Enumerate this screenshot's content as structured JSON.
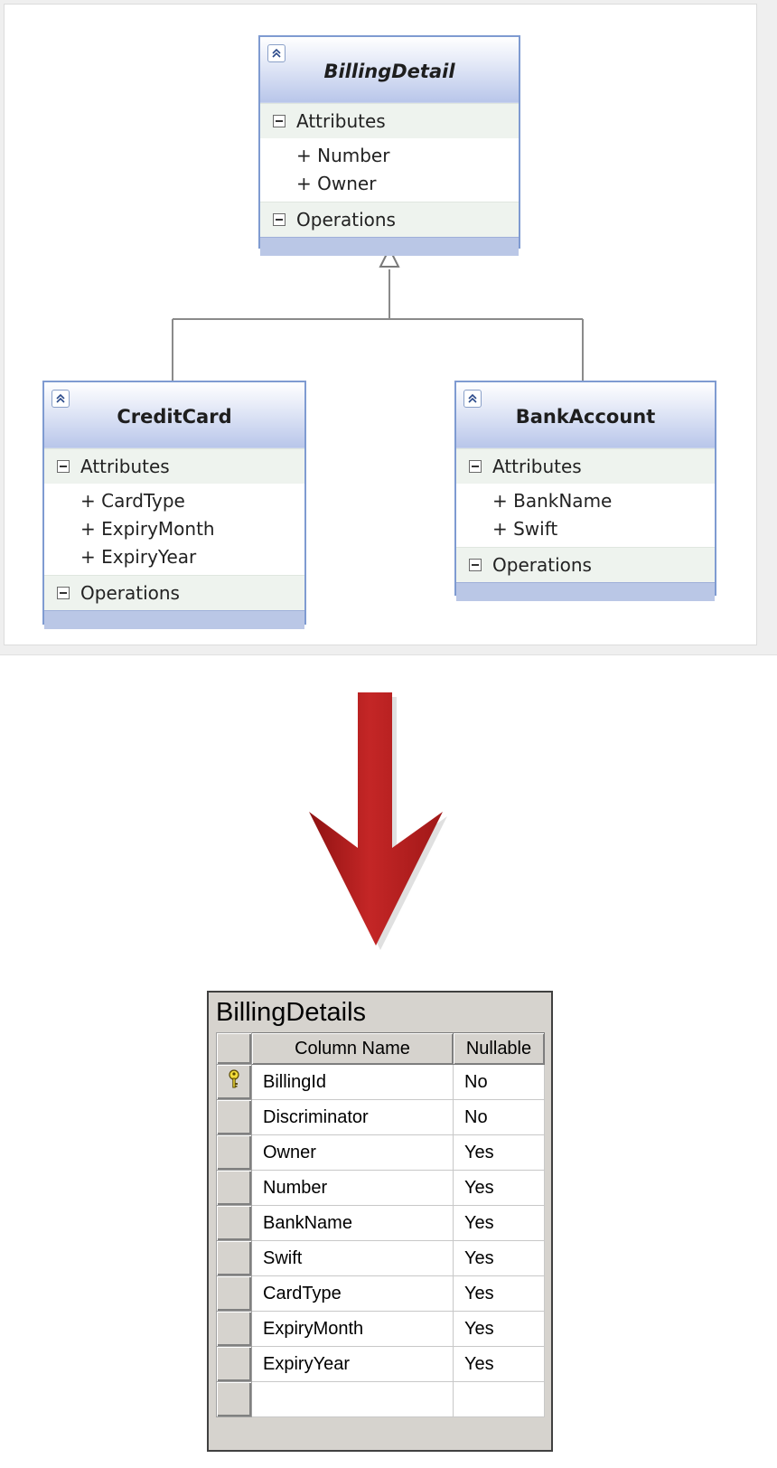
{
  "classes": {
    "billing_detail": {
      "name": "BillingDetail",
      "abstract": true,
      "attributes_label": "Attributes",
      "attributes": [
        "+ Number",
        "+ Owner"
      ],
      "operations_label": "Operations"
    },
    "credit_card": {
      "name": "CreditCard",
      "attributes_label": "Attributes",
      "attributes": [
        "+ CardType",
        "+ ExpiryMonth",
        "+ ExpiryYear"
      ],
      "operations_label": "Operations"
    },
    "bank_account": {
      "name": "BankAccount",
      "attributes_label": "Attributes",
      "attributes": [
        "+ BankName",
        "+ Swift"
      ],
      "operations_label": "Operations"
    }
  },
  "arrow": {
    "color": "#b01c1c"
  },
  "table": {
    "name": "BillingDetails",
    "headers": {
      "column_name": "Column Name",
      "nullable": "Nullable"
    },
    "rows": [
      {
        "column": "BillingId",
        "nullable": "No",
        "primary_key": true
      },
      {
        "column": "Discriminator",
        "nullable": "No"
      },
      {
        "column": "Owner",
        "nullable": "Yes"
      },
      {
        "column": "Number",
        "nullable": "Yes"
      },
      {
        "column": "BankName",
        "nullable": "Yes"
      },
      {
        "column": "Swift",
        "nullable": "Yes"
      },
      {
        "column": "CardType",
        "nullable": "Yes"
      },
      {
        "column": "ExpiryMonth",
        "nullable": "Yes"
      },
      {
        "column": "ExpiryYear",
        "nullable": "Yes"
      },
      {
        "column": "",
        "nullable": ""
      }
    ]
  },
  "colors": {
    "class_border": "#7f9bd1",
    "class_header": "#b9c6ea",
    "section_bg": "#eef3ee",
    "key_icon": "#e8d02a"
  },
  "icons": [
    "collapse-chevron-icon",
    "minus-toggle-icon",
    "primary-key-icon",
    "down-arrow-icon"
  ]
}
